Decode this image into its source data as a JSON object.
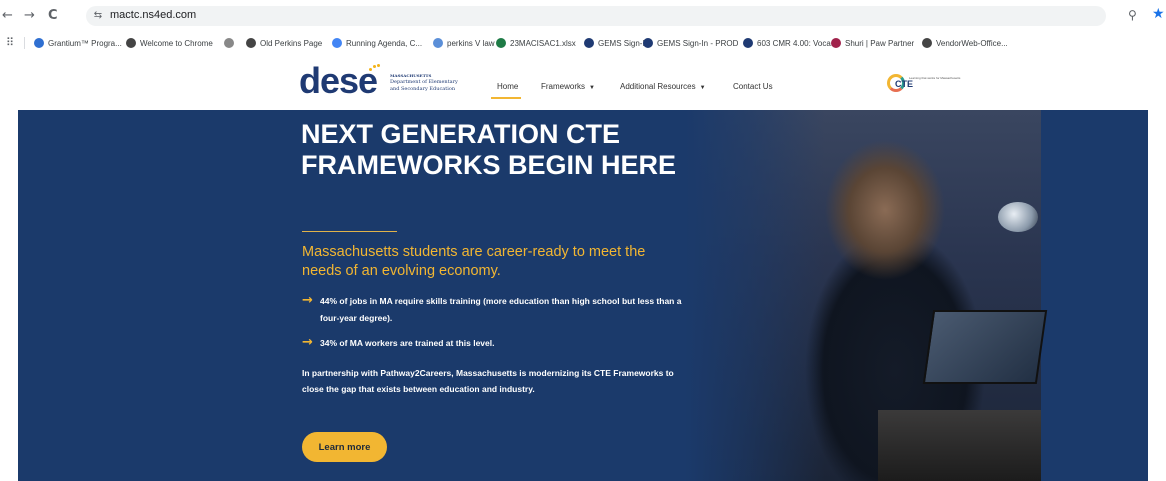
{
  "browser": {
    "back_glyph": "←",
    "forward_glyph": "→",
    "reload_glyph": "C",
    "site_info_glyph": "⇆",
    "url": "mactc.ns4ed.com",
    "zoom_glyph": "⚲",
    "star_glyph": "★",
    "apps_glyph": "⠿"
  },
  "bookmarks": [
    {
      "label": "Grantium™ Progra...",
      "icon": "grantium-icon",
      "color": "#2f6fd1"
    },
    {
      "label": "Welcome to Chrome",
      "icon": "chrome-icon",
      "color": "#444444"
    },
    {
      "label": "",
      "icon": "shield-icon",
      "color": "#888888"
    },
    {
      "label": "Old Perkins Page",
      "icon": "globe-icon",
      "color": "#444444"
    },
    {
      "label": "Running Agenda, C...",
      "icon": "docs-icon",
      "color": "#4285f4"
    },
    {
      "label": "perkins V law",
      "icon": "doc-icon",
      "color": "#5b8fd8"
    },
    {
      "label": "23MACISAC1.xlsx",
      "icon": "sheet-icon",
      "color": "#1e7b46"
    },
    {
      "label": "GEMS Sign-In",
      "icon": "shield-icon",
      "color": "#1f3a73"
    },
    {
      "label": "GEMS Sign-In - PROD",
      "icon": "shield-icon",
      "color": "#1f3a73"
    },
    {
      "label": "603 CMR 4.00: Voca...",
      "icon": "shield-icon",
      "color": "#1f3a73"
    },
    {
      "label": "Shuri | Paw Partner",
      "icon": "heart-icon",
      "color": "#a0224b"
    },
    {
      "label": "VendorWeb-Office...",
      "icon": "globe-icon",
      "color": "#444444"
    }
  ],
  "site": {
    "logo_word": "dese",
    "logo_line1": "MASSACHUSETTS",
    "logo_line2": "Department of Elementary",
    "logo_line3": "and Secondary Education",
    "menu": [
      {
        "label": "Home",
        "active": true,
        "dropdown": false
      },
      {
        "label": "Frameworks",
        "active": false,
        "dropdown": true
      },
      {
        "label": "Additional Resources",
        "active": false,
        "dropdown": true
      },
      {
        "label": "Contact Us",
        "active": false,
        "dropdown": false
      }
    ],
    "caret": "▼",
    "cte_logo_text": "CTE",
    "cte_tagline": "Learning that works for Massachusetts"
  },
  "hero": {
    "title": "NEXT GENERATION CTE FRAMEWORKS BEGIN HERE",
    "subtitle": "Massachusetts students are career-ready to meet the needs of an evolving economy.",
    "arrow": "→",
    "bullets": [
      "44% of jobs in MA require skills training (more education than high school but less than a four-year degree).",
      "34% of MA workers are trained at this level."
    ],
    "paragraph": "In partnership with Pathway2Careers, Massachusetts is modernizing its CTE Frameworks to close the gap that exists between education and industry.",
    "cta_label": "Learn more"
  },
  "colors": {
    "hero_bg": "#1b3a6b",
    "accent": "#f2b632",
    "brand": "#1f3a73"
  }
}
